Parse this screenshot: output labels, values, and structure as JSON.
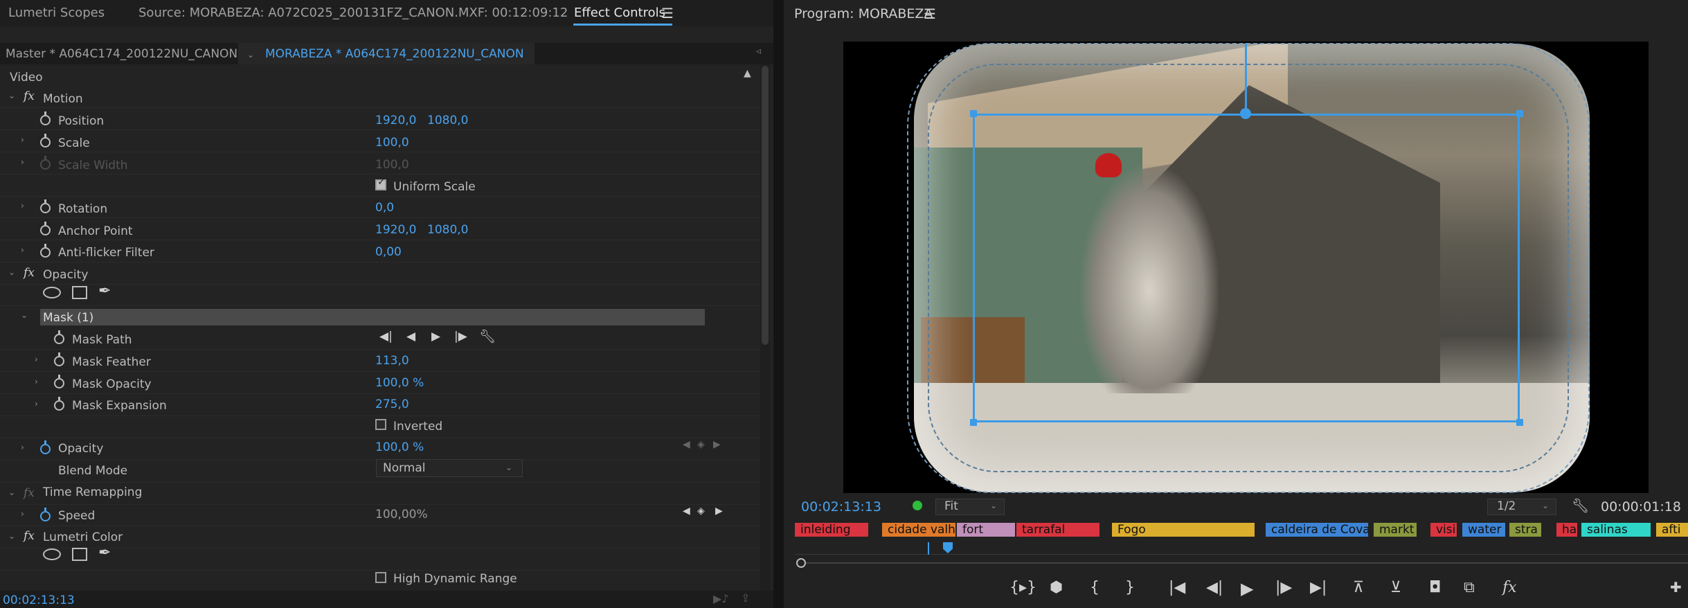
{
  "left_tabs": {
    "lumetri_scopes": "Lumetri Scopes",
    "source": "Source: MORABEZA: A072C025_200131FZ_CANON.MXF: 00:12:09:12",
    "effect_controls": "Effect Controls"
  },
  "subtabs": {
    "master": "Master * A064C174_200122NU_CANON",
    "sequence": "MORABEZA * A064C174_200122NU_CANON"
  },
  "video_header": "Video",
  "rows": {
    "motion": "Motion",
    "position": {
      "label": "Position",
      "x": "1920,0",
      "y": "1080,0"
    },
    "scale": {
      "label": "Scale",
      "value": "100,0"
    },
    "scale_width": {
      "label": "Scale Width",
      "value": "100,0"
    },
    "uniform_scale": "Uniform Scale",
    "rotation": {
      "label": "Rotation",
      "value": "0,0"
    },
    "anchor_point": {
      "label": "Anchor Point",
      "x": "1920,0",
      "y": "1080,0"
    },
    "anti_flicker": {
      "label": "Anti-flicker Filter",
      "value": "0,00"
    },
    "opacity_section": "Opacity",
    "mask": "Mask (1)",
    "mask_path": "Mask Path",
    "mask_feather": {
      "label": "Mask Feather",
      "value": "113,0"
    },
    "mask_opacity": {
      "label": "Mask Opacity",
      "value": "100,0 %"
    },
    "mask_expansion": {
      "label": "Mask Expansion",
      "value": "275,0"
    },
    "inverted": "Inverted",
    "opacity": {
      "label": "Opacity",
      "value": "100,0 %"
    },
    "blend_mode": {
      "label": "Blend Mode",
      "value": "Normal"
    },
    "time_remapping": "Time Remapping",
    "speed": {
      "label": "Speed",
      "value": "100,00%"
    },
    "lumetri_color": "Lumetri Color",
    "hdr": "High Dynamic Range"
  },
  "bottom_timecode": "00:02:13:13",
  "program": {
    "title": "Program: MORABEZA",
    "timecode": "00:02:13:13",
    "fit": "Fit",
    "resolution": "1/2",
    "duration": "00:00:01:18"
  },
  "markers": [
    {
      "label": "inleiding",
      "color": "#d9343f"
    },
    {
      "label": "cidade valh",
      "color": "#e07a2a"
    },
    {
      "label": "fort",
      "color": "#c08fba"
    },
    {
      "label": "tarrafal",
      "color": "#d9343f"
    },
    {
      "label": "Fogo",
      "color": "#dcae2e"
    },
    {
      "label": "caldeira de Cova",
      "color": "#3d84d6"
    },
    {
      "label": "markt",
      "color": "#8a9a3e"
    },
    {
      "label": "visi",
      "color": "#d9343f"
    },
    {
      "label": "water",
      "color": "#3d84d6"
    },
    {
      "label": "stra",
      "color": "#8a9a3e"
    },
    {
      "label": "hai",
      "color": "#d9343f"
    },
    {
      "label": "salinas",
      "color": "#2fd6c8"
    },
    {
      "label": "afti",
      "color": "#dcae2e"
    }
  ]
}
